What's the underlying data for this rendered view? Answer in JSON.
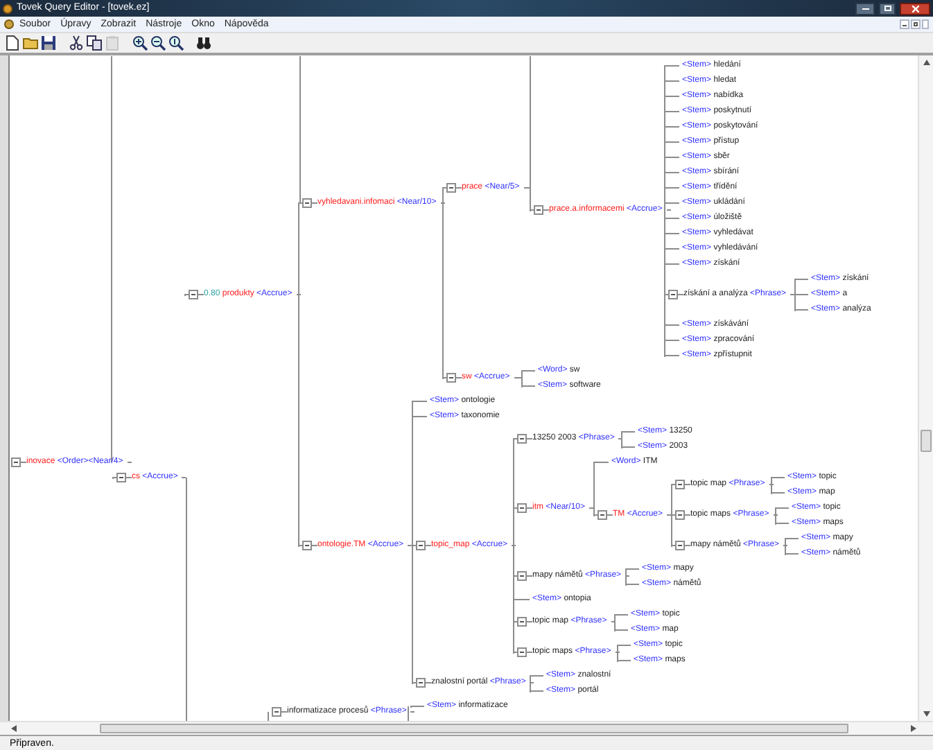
{
  "window": {
    "title": "Tovek Query Editor - [tovek.ez]"
  },
  "menu": [
    "Soubor",
    "Úpravy",
    "Zobrazit",
    "Nástroje",
    "Okno",
    "Nápověda"
  ],
  "toolbar": [
    {
      "kind": "new",
      "disabled": false
    },
    {
      "kind": "open",
      "disabled": false
    },
    {
      "kind": "save",
      "disabled": false
    },
    {
      "kind": "cut",
      "disabled": false
    },
    {
      "kind": "copy",
      "disabled": false
    },
    {
      "kind": "paste",
      "disabled": true
    },
    {
      "kind": "zoom-in",
      "disabled": false
    },
    {
      "kind": "zoom-out",
      "disabled": false
    },
    {
      "kind": "zoom-fit",
      "disabled": false
    },
    {
      "kind": "find",
      "disabled": false
    }
  ],
  "tree": {
    "nodes": [
      {
        "kind": "concept",
        "label": "inovace",
        "operator": "<Order><Near/4>",
        "children": [
          {
            "kind": "concept",
            "label": "cs",
            "operator": "<Accrue>",
            "children": [
              {
                "kind": "concept",
                "weight": "0.80",
                "label": "produkty",
                "operator": "<Accrue>",
                "children": [
                  {
                    "kind": "concept",
                    "label": "vyhledavani.infomaci",
                    "operator": "<Near/10>",
                    "children": [
                      {
                        "kind": "concept",
                        "label": "prace",
                        "operator": "<Near/5>",
                        "children": [
                          {
                            "kind": "concept",
                            "label": "prace.a.informacemi",
                            "operator": "<Accrue>",
                            "children": [
                              {
                                "kind": "term",
                                "operator": "<Stem>",
                                "label": "hledání"
                              },
                              {
                                "kind": "term",
                                "operator": "<Stem>",
                                "label": "hledat"
                              },
                              {
                                "kind": "term",
                                "operator": "<Stem>",
                                "label": "nabídka"
                              },
                              {
                                "kind": "term",
                                "operator": "<Stem>",
                                "label": "poskytnutí"
                              },
                              {
                                "kind": "term",
                                "operator": "<Stem>",
                                "label": "poskytování"
                              },
                              {
                                "kind": "term",
                                "operator": "<Stem>",
                                "label": "přístup"
                              },
                              {
                                "kind": "term",
                                "operator": "<Stem>",
                                "label": "sběr"
                              },
                              {
                                "kind": "term",
                                "operator": "<Stem>",
                                "label": "sbírání"
                              },
                              {
                                "kind": "term",
                                "operator": "<Stem>",
                                "label": "třídění"
                              },
                              {
                                "kind": "term",
                                "operator": "<Stem>",
                                "label": "ukládání"
                              },
                              {
                                "kind": "term",
                                "operator": "<Stem>",
                                "label": "úložiště"
                              },
                              {
                                "kind": "term",
                                "operator": "<Stem>",
                                "label": "vyhledávat"
                              },
                              {
                                "kind": "term",
                                "operator": "<Stem>",
                                "label": "vyhledávání"
                              },
                              {
                                "kind": "term",
                                "operator": "<Stem>",
                                "label": "získání"
                              },
                              {
                                "kind": "phrase",
                                "label": "získání a analýza",
                                "operator": "<Phrase>",
                                "children": [
                                  {
                                    "kind": "term",
                                    "operator": "<Stem>",
                                    "label": "získání"
                                  },
                                  {
                                    "kind": "term",
                                    "operator": "<Stem>",
                                    "label": "a"
                                  },
                                  {
                                    "kind": "term",
                                    "operator": "<Stem>",
                                    "label": "analýza"
                                  }
                                ]
                              },
                              {
                                "kind": "term",
                                "operator": "<Stem>",
                                "label": "získávání"
                              },
                              {
                                "kind": "term",
                                "operator": "<Stem>",
                                "label": "zpracování"
                              },
                              {
                                "kind": "term",
                                "operator": "<Stem>",
                                "label": "zpřístupnit"
                              }
                            ]
                          }
                        ]
                      },
                      {
                        "kind": "concept",
                        "label": "sw",
                        "operator": "<Accrue>",
                        "children": [
                          {
                            "kind": "term",
                            "operator": "<Word>",
                            "label": "sw"
                          },
                          {
                            "kind": "term",
                            "operator": "<Stem>",
                            "label": "software"
                          }
                        ]
                      }
                    ]
                  },
                  {
                    "kind": "concept",
                    "label": "ontologie.TM",
                    "operator": "<Accrue>",
                    "children": [
                      {
                        "kind": "term",
                        "operator": "<Stem>",
                        "label": "ontologie"
                      },
                      {
                        "kind": "term",
                        "operator": "<Stem>",
                        "label": "taxonomie"
                      },
                      {
                        "kind": "concept",
                        "label": "topic_map",
                        "operator": "<Accrue>",
                        "children": [
                          {
                            "kind": "phrase",
                            "label": "13250 2003",
                            "operator": "<Phrase>",
                            "children": [
                              {
                                "kind": "term",
                                "operator": "<Stem>",
                                "label": "13250"
                              },
                              {
                                "kind": "term",
                                "operator": "<Stem>",
                                "label": "2003"
                              }
                            ]
                          },
                          {
                            "kind": "concept",
                            "label": "itm",
                            "operator": "<Near/10>",
                            "children": [
                              {
                                "kind": "term",
                                "operator": "<Word>",
                                "label": "ITM"
                              },
                              {
                                "kind": "concept",
                                "label": "TM",
                                "operator": "<Accrue>",
                                "children": [
                                  {
                                    "kind": "phrase",
                                    "label": "topic map",
                                    "operator": "<Phrase>",
                                    "children": [
                                      {
                                        "kind": "term",
                                        "operator": "<Stem>",
                                        "label": "topic"
                                      },
                                      {
                                        "kind": "term",
                                        "operator": "<Stem>",
                                        "label": "map"
                                      }
                                    ]
                                  },
                                  {
                                    "kind": "phrase",
                                    "label": "topic maps",
                                    "operator": "<Phrase>",
                                    "children": [
                                      {
                                        "kind": "term",
                                        "operator": "<Stem>",
                                        "label": "topic"
                                      },
                                      {
                                        "kind": "term",
                                        "operator": "<Stem>",
                                        "label": "maps"
                                      }
                                    ]
                                  },
                                  {
                                    "kind": "phrase",
                                    "label": "mapy námětů",
                                    "operator": "<Phrase>",
                                    "children": [
                                      {
                                        "kind": "term",
                                        "operator": "<Stem>",
                                        "label": "mapy"
                                      },
                                      {
                                        "kind": "term",
                                        "operator": "<Stem>",
                                        "label": "námětů"
                                      }
                                    ]
                                  }
                                ]
                              }
                            ]
                          },
                          {
                            "kind": "phrase",
                            "label": "mapy námětů",
                            "operator": "<Phrase>",
                            "children": [
                              {
                                "kind": "term",
                                "operator": "<Stem>",
                                "label": "mapy"
                              },
                              {
                                "kind": "term",
                                "operator": "<Stem>",
                                "label": "námětů"
                              }
                            ]
                          },
                          {
                            "kind": "term",
                            "operator": "<Stem>",
                            "label": "ontopia"
                          },
                          {
                            "kind": "phrase",
                            "label": "topic map",
                            "operator": "<Phrase>",
                            "children": [
                              {
                                "kind": "term",
                                "operator": "<Stem>",
                                "label": "topic"
                              },
                              {
                                "kind": "term",
                                "operator": "<Stem>",
                                "label": "map"
                              }
                            ]
                          },
                          {
                            "kind": "phrase",
                            "label": "topic maps",
                            "operator": "<Phrase>",
                            "children": [
                              {
                                "kind": "term",
                                "operator": "<Stem>",
                                "label": "topic"
                              },
                              {
                                "kind": "term",
                                "operator": "<Stem>",
                                "label": "maps"
                              }
                            ]
                          }
                        ]
                      },
                      {
                        "kind": "phrase",
                        "label": "znalostní portál",
                        "operator": "<Phrase>",
                        "children": [
                          {
                            "kind": "term",
                            "operator": "<Stem>",
                            "label": "znalostní"
                          },
                          {
                            "kind": "term",
                            "operator": "<Stem>",
                            "label": "portál"
                          }
                        ]
                      }
                    ]
                  }
                ]
              }
            ]
          }
        ]
      },
      {
        "kind": "phrase",
        "label": "informatizace procesů",
        "operator": "<Phrase>",
        "children": [
          {
            "kind": "term",
            "operator": "<Stem>",
            "label": "informatizace"
          }
        ]
      }
    ]
  },
  "status_bar": "Připraven."
}
